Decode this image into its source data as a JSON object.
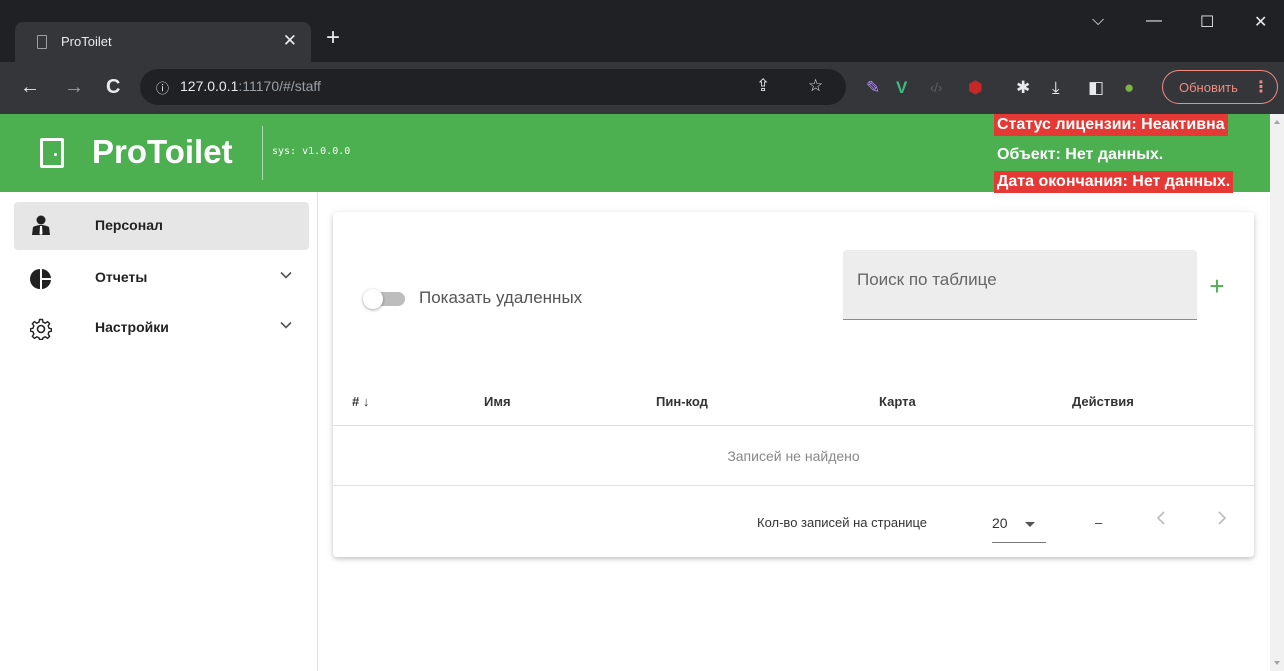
{
  "browser": {
    "tab_title": "ProToilet",
    "url_host": "127.0.0.1",
    "url_rest": ":11170/#/staff",
    "update_label": "Обновить"
  },
  "header": {
    "brand": "ProToilet",
    "version": "sys: v1.0.0.0",
    "license_status": "Статус лицензии: Неактивна",
    "object": "Объект: Нет данных.",
    "expiry": "Дата окончания: Нет данных."
  },
  "sidebar": {
    "items": [
      {
        "label": "Персонал",
        "icon": "staff-icon",
        "active": true
      },
      {
        "label": "Отчеты",
        "icon": "pie-chart-icon",
        "expandable": true
      },
      {
        "label": "Настройки",
        "icon": "gear-icon",
        "expandable": true
      }
    ]
  },
  "card": {
    "toggle_label": "Показать удаленных",
    "toggle_on": false,
    "search_placeholder": "Поиск по таблице",
    "search_value": "",
    "columns": [
      "#",
      "Имя",
      "Пин-код",
      "Карта",
      "Действия"
    ],
    "empty_text": "Записей не найдено",
    "rows_per_page_label": "Кол-во записей на странице",
    "rows_per_page": "20",
    "page_range": "–"
  },
  "colors": {
    "brand_green": "#4caf50",
    "alert_red": "#e53935"
  }
}
